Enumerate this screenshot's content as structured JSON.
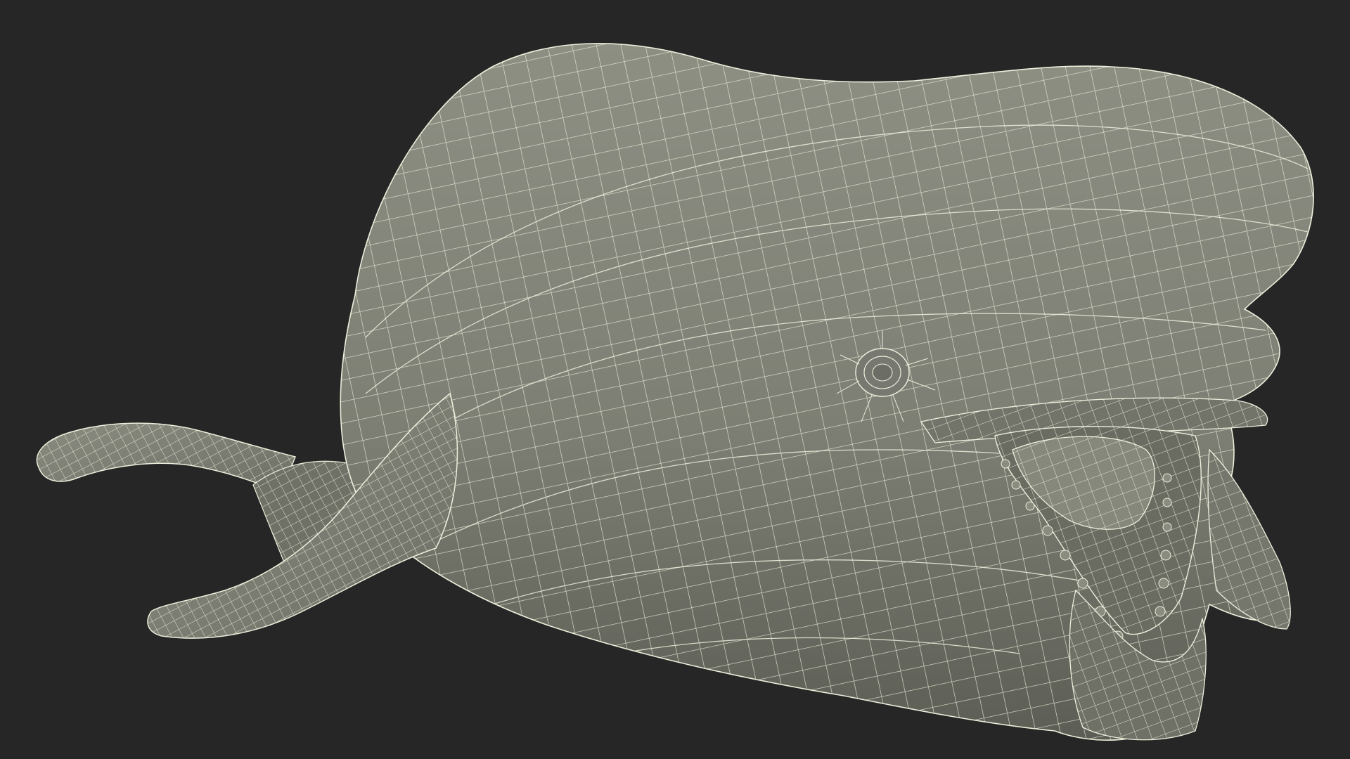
{
  "scene": {
    "subject": "wireframe-whale-model",
    "background_color": "#262626",
    "mesh_fill_color": "#7d7f74",
    "mesh_shadow_color": "#5c5e55",
    "mesh_highlight_color": "#8d8f83",
    "wire_color": "#eeeedc",
    "mouth_interior_color": "#6a6c62",
    "tongue_color": "#86887c"
  }
}
